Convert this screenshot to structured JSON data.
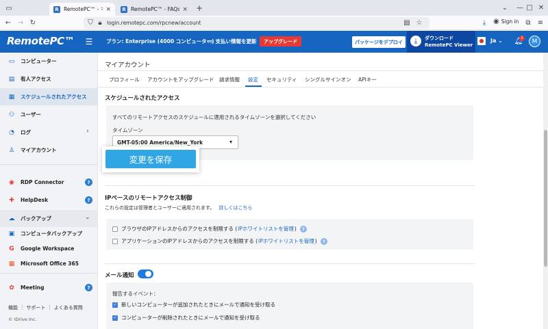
{
  "browser": {
    "tabs": [
      {
        "title": "RemotePC™ - マイアカウント",
        "active": true
      },
      {
        "title": "RemotePC™ - FAQs on Remote",
        "active": false
      }
    ],
    "url": "login.remotepc.com/rpcnew/account",
    "signin_label": "Sign in"
  },
  "header": {
    "logo": "RemotePC™",
    "plan": "プラン: Enterprise (4000 コンピューター)",
    "payment_link": "支払い情報を更新",
    "upgrade_label": "アップグレード",
    "deploy_label": "パッケージをデプロイ",
    "download_line1": "ダウンロード",
    "download_line2": "RemotePC Viewer",
    "language": "Ja",
    "notification_count": "1",
    "avatar_letter": "M",
    "brand_color": "#1565c0"
  },
  "sidebar": {
    "items": [
      {
        "label": "コンピューター",
        "icon": "monitor-icon"
      },
      {
        "label": "有人アクセス",
        "icon": "attended-access-icon"
      },
      {
        "label": "スケジュールされたアクセス",
        "icon": "calendar-icon",
        "active": true
      },
      {
        "label": "ユーザー",
        "icon": "users-icon"
      },
      {
        "label": "ログ",
        "icon": "log-icon"
      },
      {
        "label": "マイアカウント",
        "icon": "person-icon"
      }
    ],
    "rdp": "RDP Connector",
    "helpdesk": "HelpDesk",
    "backup": "バックアップ",
    "backup_items": [
      "コンピュータバックアップ",
      "Google Workspace",
      "Microsoft Office 365"
    ],
    "meeting": "Meeting",
    "footer_links": [
      "機能",
      "サポート",
      "よくある質問"
    ],
    "copyright": "© IDrive Inc."
  },
  "main": {
    "title": "マイアカウント",
    "tabs": [
      "プロフィール",
      "アカウントをアップグレード",
      "請求情報",
      "設定",
      "セキュリティ",
      "シングルサインオン",
      "APIキー"
    ],
    "active_tab": "設定",
    "scheduled": {
      "heading": "スケジュールされたアクセス",
      "description": "すべてのリモートアクセスのスケジュールに適用されるタイムゾーンを選択してください",
      "timezone_label": "タイムゾーン",
      "timezone_value": "GMT-05:00 America/New_York",
      "save_label": "変更を保存"
    },
    "ip": {
      "heading": "IPベースのリモートアクセス制御",
      "description": "これらの設定は管理者とユーザーに適用されます。",
      "details_link": "詳しくはこちら",
      "option1_text": "ブラウザのIPアドレスからのアクセスを制限する (",
      "option1_link": "IPホワイトリストを管理",
      "option2_text": "アプリケーションのIPアドレスからのアクセスを制限する (",
      "option2_link": "IPホワイトリストを管理",
      "close_paren": ")"
    },
    "email": {
      "heading": "メール通知",
      "enabled": true,
      "events_label": "報告するイベント：",
      "events": [
        "新しいコンピューターが追加されたときにメールで通知を受け取る",
        "コンピューターが削除されたときにメールで通知を受け取る"
      ]
    }
  }
}
